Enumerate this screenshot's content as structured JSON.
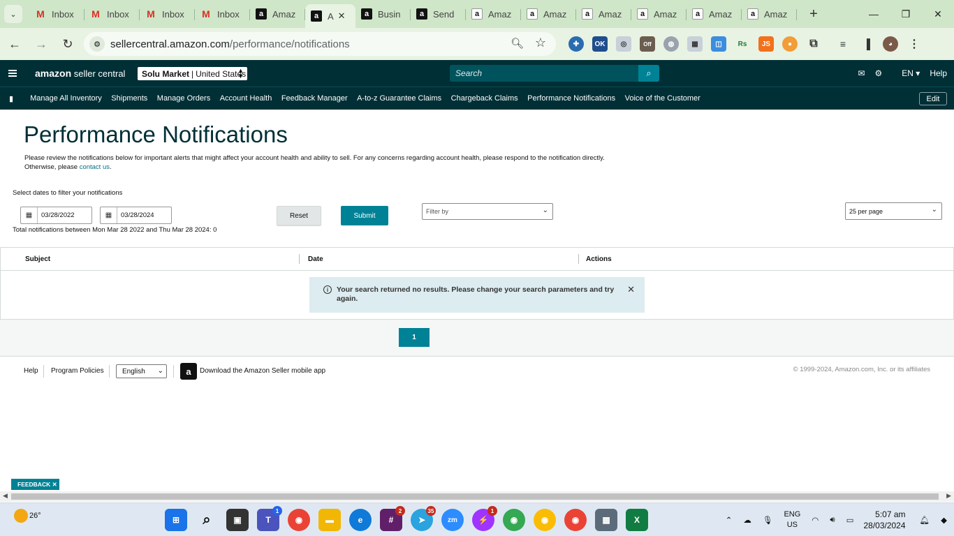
{
  "browser": {
    "tabs": [
      {
        "label": "Inbox",
        "icon": "gmail-icon"
      },
      {
        "label": "Inbox",
        "icon": "gmail-icon"
      },
      {
        "label": "Inbox",
        "icon": "gmail-icon"
      },
      {
        "label": "Inbox",
        "icon": "gmail-icon"
      },
      {
        "label": "Amaz",
        "icon": "amazon-icon"
      },
      {
        "label": "A",
        "icon": "amazon-icon",
        "active": true
      },
      {
        "label": "Busin",
        "icon": "amazon-icon"
      },
      {
        "label": "Send",
        "icon": "amazon-icon"
      },
      {
        "label": "Amaz",
        "icon": "amazon-smile-icon"
      },
      {
        "label": "Amaz",
        "icon": "amazon-smile-icon"
      },
      {
        "label": "Amaz",
        "icon": "amazon-smile-icon"
      },
      {
        "label": "Amaz",
        "icon": "amazon-smile-icon"
      },
      {
        "label": "Amaz",
        "icon": "amazon-smile-icon"
      },
      {
        "label": "Amaz",
        "icon": "amazon-smile-icon"
      }
    ],
    "url_host": "sellercentral.amazon.com",
    "url_path": "/performance/notifications",
    "colors": {
      "tabstrip": "#cfe6c8",
      "toolbar": "#e8f3e4"
    }
  },
  "header": {
    "logo_bold": "amazon",
    "logo_text": " seller central",
    "store": "Solu Market",
    "region": "United States",
    "search_placeholder": "Search",
    "language": "EN",
    "help": "Help",
    "colors": {
      "bg": "#002f36",
      "accent": "#008296"
    }
  },
  "nav": {
    "items": [
      "Manage All Inventory",
      "Shipments",
      "Manage Orders",
      "Account Health",
      "Feedback Manager",
      "A-to-z Guarantee Claims",
      "Chargeback Claims",
      "Performance Notifications",
      "Voice of the Customer"
    ],
    "edit": "Edit"
  },
  "main": {
    "title": "Performance Notifications",
    "description": "Please review the notifications below for important alerts that might affect your account health and ability to sell. For any concerns regarding account health, please respond to the notification directly.",
    "description_line2_prefix": "Otherwise, please ",
    "contact_link": "contact us",
    "description_line2_suffix": ".",
    "filter_label": "Select dates to filter your notifications",
    "start_date": "03/28/2022",
    "end_date": "03/28/2024",
    "reset": "Reset",
    "submit": "Submit",
    "filter_by": "Filter by",
    "per_page": "25 per page",
    "total": "Total notifications between Mon Mar 28 2022 and Thu Mar 28 2024: 0",
    "columns": [
      "Subject",
      "Date",
      "Actions"
    ],
    "no_results": "Your search returned no results. Please change your search parameters and try again.",
    "page": "1"
  },
  "footer": {
    "help": "Help",
    "policies": "Program Policies",
    "language": "English",
    "app_text": "Download the Amazon Seller mobile app",
    "copyright": "© 1999-2024, Amazon.com, Inc. or its affiliates",
    "feedback": "FEEDBACK"
  },
  "taskbar": {
    "temperature": "26°",
    "lang_line1": "ENG",
    "lang_line2": "US",
    "time": "5:07 am",
    "date": "28/03/2024",
    "badges": {
      "teams": "1",
      "slack": "2",
      "telegram": "35",
      "messenger": "1"
    }
  }
}
